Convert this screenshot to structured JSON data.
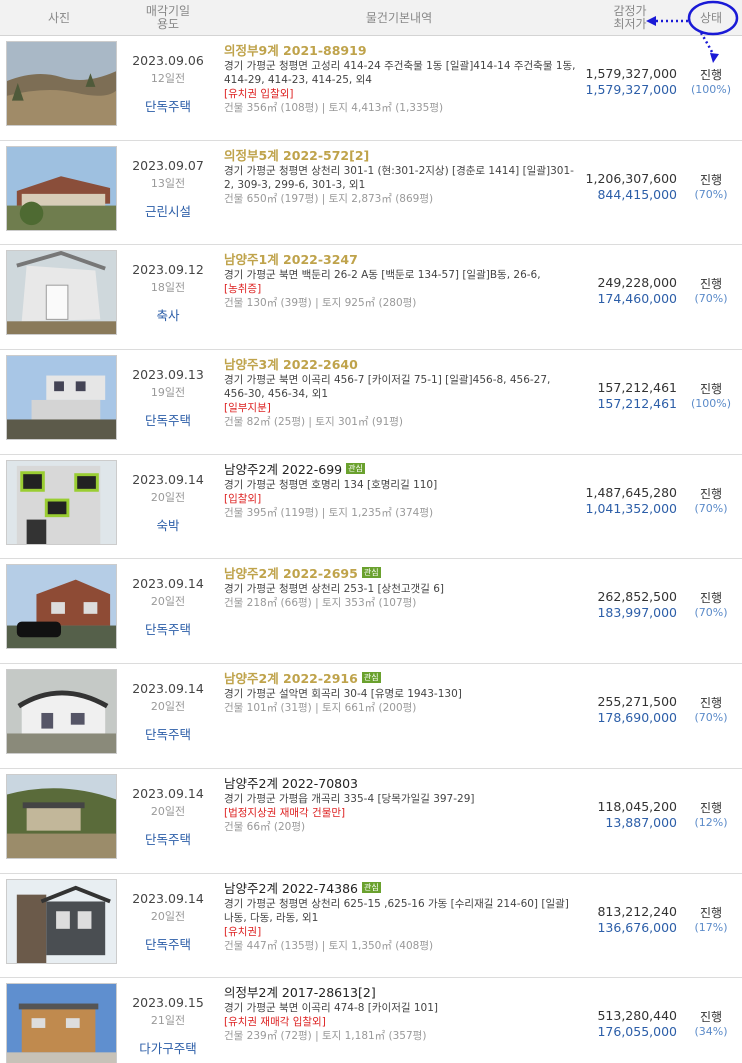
{
  "header": {
    "photo": "사진",
    "date_line1": "매각기일",
    "date_line2": "용도",
    "info": "물건기본내역",
    "price_line1": "감정가",
    "price_line2": "최저가",
    "status": "상태"
  },
  "colors": {
    "accent_blue": "#2c5ea8",
    "case_gold": "#bfa34b",
    "tag_red": "#d22222",
    "badge_green": "#6aa12e",
    "annotation_blue": "#1a1ad6"
  },
  "rows": [
    {
      "date": "2023.09.06",
      "days": "12일전",
      "usage": "단독주택",
      "case_no": "의정부9계 2021-88919",
      "badge": "",
      "address": "경기 가평군 청평면 고성리 414-24 주건축물 1동 [일괄]414-14 주건축물 1동, 414-29, 414-23, 414-25, 외4",
      "tags": "[유치권  입찰외]",
      "size": "건물 356㎡ (108평)  |  토지 4,413㎡ (1,335평)",
      "appraisal": "1,579,327,000",
      "minimum": "1,579,327,000",
      "status": "진행",
      "pct": "(100%)",
      "photo_icon": "land-lot-photo"
    },
    {
      "date": "2023.09.07",
      "days": "13일전",
      "usage": "근린시설",
      "case_no": "의정부5계 2022-572[2]",
      "badge": "",
      "address": "경기 가평군 청평면 상천리 301-1 (현:301-2지상) [경춘로 1414] [일괄]301-2, 309-3, 299-6, 301-3, 외1",
      "tags": "",
      "size": "건물 650㎡ (197평)  |  토지 2,873㎡ (869평)",
      "appraisal": "1,206,307,600",
      "minimum": "844,415,000",
      "status": "진행",
      "pct": "(70%)",
      "photo_icon": "long-building-photo"
    },
    {
      "date": "2023.09.12",
      "days": "18일전",
      "usage": "축사",
      "case_no": "남양주1계 2022-3247",
      "badge": "",
      "address": "경기 가평군 북면 백둔리 26-2 A동 [백둔로 134-57] [일괄]B동, 26-6,",
      "tags": "[농취증]",
      "size": "건물 130㎡ (39평)  |  토지 925㎡ (280평)",
      "appraisal": "249,228,000",
      "minimum": "174,460,000",
      "status": "진행",
      "pct": "(70%)",
      "photo_icon": "barn-photo"
    },
    {
      "date": "2023.09.13",
      "days": "19일전",
      "usage": "단독주택",
      "case_no": "남양주3계 2022-2640",
      "badge": "",
      "address": "경기 가평군 북면 이곡리 456-7 [카이저길 75-1] [일괄]456-8, 456-27, 456-30, 456-34, 외1",
      "tags": "[일부지분]",
      "size": "건물 82㎡ (25평)  |  토지 301㎡ (91평)",
      "appraisal": "157,212,461",
      "minimum": "157,212,461",
      "status": "진행",
      "pct": "(100%)",
      "photo_icon": "modular-house-photo"
    },
    {
      "date": "2023.09.14",
      "days": "20일전",
      "usage": "숙박",
      "case_no": "남양주2계 2022-699",
      "badge": "관심",
      "address": "경기 가평군 청평면 호명리 134 [호명리길 110]",
      "tags": "[입찰외]",
      "size": "건물 395㎡ (119평)  |  토지 1,235㎡ (374평)",
      "appraisal": "1,487,645,280",
      "minimum": "1,041,352,000",
      "status": "진행",
      "pct": "(70%)",
      "photo_icon": "modern-lodging-photo"
    },
    {
      "date": "2023.09.14",
      "days": "20일전",
      "usage": "단독주택",
      "case_no": "남양주2계 2022-2695",
      "badge": "관심",
      "address": "경기 가평군 청평면 상천리 253-1 [상천고갯길 6]",
      "tags": "",
      "size": "건물 218㎡ (66평)  |  토지 353㎡ (107평)",
      "appraisal": "262,852,500",
      "minimum": "183,997,000",
      "status": "진행",
      "pct": "(70%)",
      "photo_icon": "brick-house-photo"
    },
    {
      "date": "2023.09.14",
      "days": "20일전",
      "usage": "단독주택",
      "case_no": "남양주2계 2022-2916",
      "badge": "관심",
      "address": "경기 가평군 설악면 회곡리 30-4 [유명로 1943-130]",
      "tags": "",
      "size": "건물 101㎡ (31평)  |  토지 661㎡ (200평)",
      "appraisal": "255,271,500",
      "minimum": "178,690,000",
      "status": "진행",
      "pct": "(70%)",
      "photo_icon": "cottage-photo"
    },
    {
      "date": "2023.09.14",
      "days": "20일전",
      "usage": "단독주택",
      "case_no": "남양주2계 2022-70803",
      "badge": "",
      "address": "경기 가평군 가평읍 개곡리 335-4 [당목가일길 397-29]",
      "tags": "[법정지상권  재매각  건물만]",
      "size": "건물 66㎡ (20평)",
      "appraisal": "118,045,200",
      "minimum": "13,887,000",
      "status": "진행",
      "pct": "(12%)",
      "photo_icon": "hillside-house-photo"
    },
    {
      "date": "2023.09.14",
      "days": "20일전",
      "usage": "단독주택",
      "case_no": "남양주2계 2022-74386",
      "badge": "관심",
      "address": "경기 가평군 청평면 상천리 625-15 ,625-16 가동 [수리재길 214-60] [일괄]나동, 다동, 라동, 외1",
      "tags": "[유치권]",
      "size": "건물 447㎡ (135평)  |  토지 1,350㎡ (408평)",
      "appraisal": "813,212,240",
      "minimum": "136,676,000",
      "status": "진행",
      "pct": "(17%)",
      "photo_icon": "stone-house-photo"
    },
    {
      "date": "2023.09.15",
      "days": "21일전",
      "usage": "다가구주택",
      "case_no": "의정부2계 2017-28613[2]",
      "badge": "",
      "address": "경기 가평군 북면 이곡리 474-8 [카이저길 101]",
      "tags": "[유치권  재매각  입찰외]",
      "size": "건물 239㎡ (72평)  |  토지 1,181㎡ (357평)",
      "appraisal": "513,280,440",
      "minimum": "176,055,000",
      "status": "진행",
      "pct": "(34%)",
      "photo_icon": "multi-family-photo"
    }
  ]
}
